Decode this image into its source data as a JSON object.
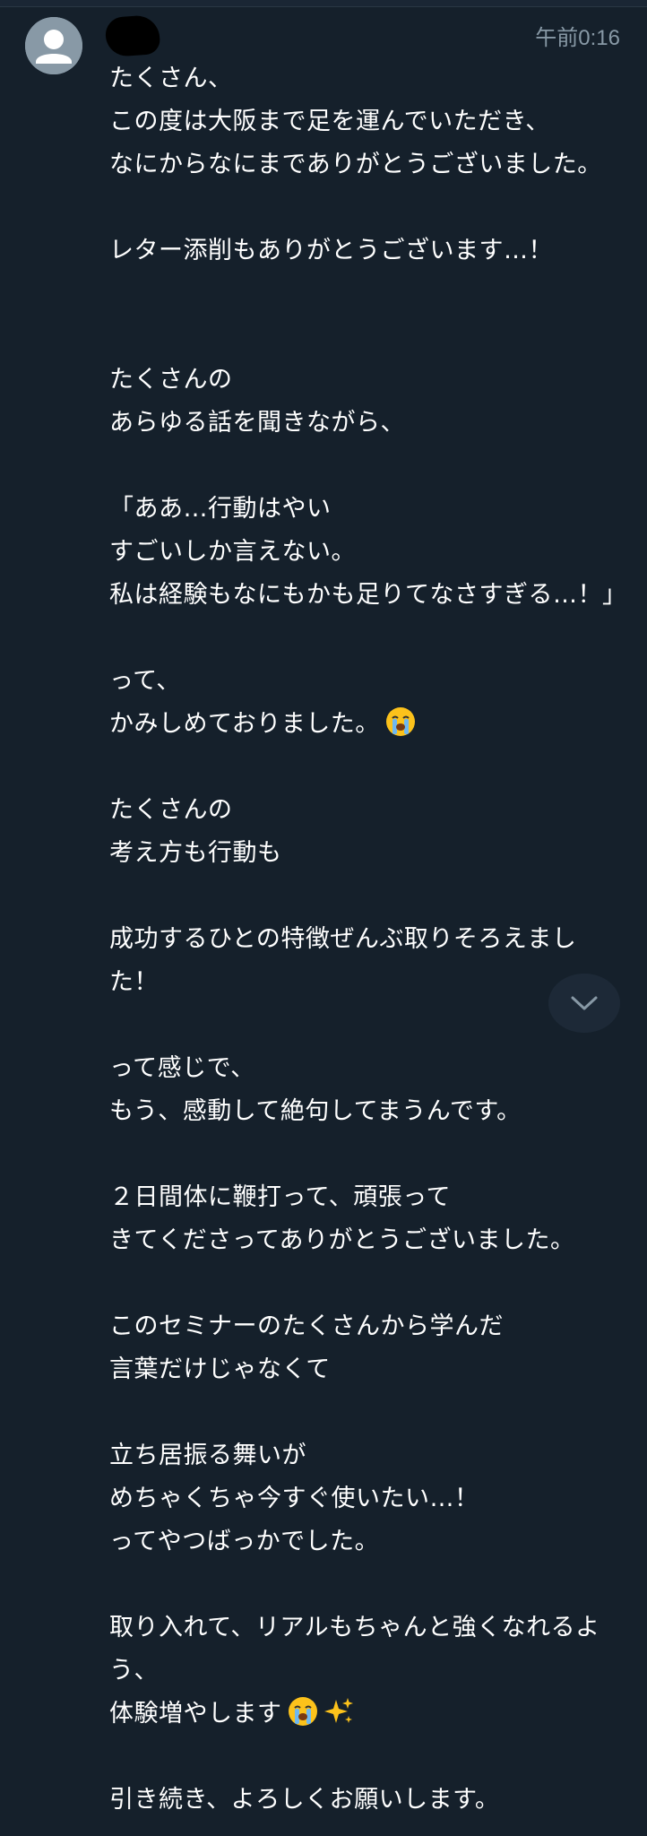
{
  "header": {
    "timestamp": "午前0:16"
  },
  "message": {
    "lines": [
      "たくさん、",
      "この度は大阪まで足を運んでいただき、",
      "なにからなにまでありがとうございました。",
      "",
      "レター添削もありがとうございます…！",
      "",
      "",
      "たくさんの",
      "あらゆる話を聞きながら、",
      "",
      "「ああ…行動はやい",
      "すごいしか言えない。",
      "私は経験もなにもかも足りてなさすぎる…！」",
      "",
      "って、",
      "かみしめておりました。",
      "",
      "たくさんの",
      "考え方も行動も",
      "",
      "成功するひとの特徴ぜんぶ取りそろえまし",
      "た！",
      "",
      "って感じで、",
      "もう、感動して絶句してまうんです。",
      "",
      "２日間体に鞭打って、頑張って",
      "きてくださってありがとうございました。",
      "",
      "このセミナーのたくさんから学んだ",
      "言葉だけじゃなくて",
      "",
      "立ち居振る舞いが",
      "めちゃくちゃ今すぐ使いたい…！",
      "ってやつばっかでした。",
      "",
      "取り入れて、リアルもちゃんと強くなれるよ",
      "う、",
      "体験増やします",
      "",
      "引き続き、よろしくお願いします。"
    ]
  },
  "icons": {
    "avatar": "default-profile-avatar",
    "crying_emoji": "loudly-crying-face-emoji",
    "sparkles_emoji": "sparkles-emoji",
    "scroll_down": "chevron-down-icon"
  },
  "colors": {
    "background": "#15202b",
    "text": "#ffffff",
    "secondary_text": "#8899a6"
  }
}
